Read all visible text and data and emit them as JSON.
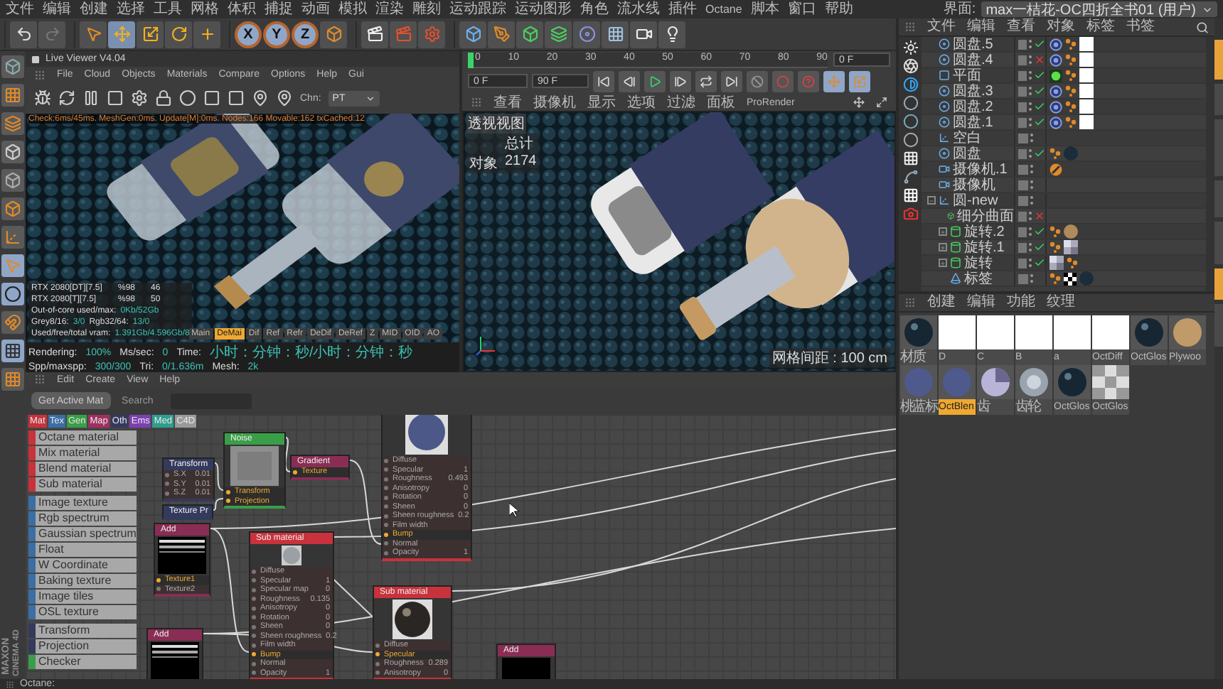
{
  "menu_bar": [
    "文件",
    "编辑",
    "创建",
    "选择",
    "工具",
    "网格",
    "体积",
    "捕捉",
    "动画",
    "模拟",
    "渲染",
    "雕刻",
    "运动跟踪",
    "运动图形",
    "角色",
    "流水线",
    "插件",
    "Octane",
    "脚本",
    "窗口",
    "帮助"
  ],
  "layout": {
    "label": "界面:",
    "value": "max一桔花-OC四折全书01 (用户)"
  },
  "toolbar": {
    "axes": [
      "X",
      "Y",
      "Z"
    ]
  },
  "live_viewer": {
    "title": "Live Viewer V4.04",
    "menu": [
      "File",
      "Cloud",
      "Objects",
      "Materials",
      "Compare",
      "Options",
      "Help",
      "Gui"
    ],
    "channel": {
      "label": "Chn:",
      "value": "PT"
    },
    "check_line": "Check:6ms/45ms. MeshGen:0ms. Update[M]:0ms. Nodes:166 Movable:162 txCached:12",
    "gpus": [
      {
        "name": "RTX 2080[DT][7.5]",
        "load": "%98",
        "temp": "46"
      },
      {
        "name": "RTX 2080[T][7.5]",
        "load": "%98",
        "temp": "50"
      }
    ],
    "memory_lines": [
      [
        {
          "label": "Out-of-core used/max:",
          "value": "0Kb/52Gb"
        }
      ],
      [
        {
          "label": "Grey8/16:",
          "value": "3/0"
        },
        {
          "label": "Rgb32/64:",
          "value": "13/0"
        }
      ],
      [
        {
          "label": "Used/free/total vram:",
          "value": "1.391Gb/4.596Gb/8"
        }
      ]
    ],
    "passes": [
      {
        "label": "Main",
        "selected": false
      },
      {
        "label": "DeMai",
        "selected": true
      },
      {
        "label": "Dif",
        "selected": false
      },
      {
        "label": "Ref",
        "selected": false
      },
      {
        "label": "Refr",
        "selected": false
      },
      {
        "label": "DeDif",
        "selected": false
      },
      {
        "label": "DeRef",
        "selected": false
      },
      {
        "label": "Z",
        "selected": false
      },
      {
        "label": "MID",
        "selected": false
      },
      {
        "label": "OID",
        "selected": false
      },
      {
        "label": "AO",
        "selected": false
      }
    ],
    "status": [
      {
        "label": "Rendering:",
        "value": "100%"
      },
      {
        "label": "Ms/sec:",
        "value": "0"
      },
      {
        "label": "Time:",
        "value": "小时：分钟：秒/小时：分钟：秒"
      },
      {
        "label": "Spp/maxspp:",
        "value": "300/300"
      },
      {
        "label": "Tri:",
        "value": "0/1.636m"
      },
      {
        "label": "Mesh:",
        "value": "2k"
      }
    ]
  },
  "timeline": {
    "ticks": [
      "0",
      "10",
      "20",
      "30",
      "40",
      "50",
      "60",
      "70",
      "80",
      "90"
    ],
    "current_field": "0 F",
    "start_field": "0 F",
    "end_field": "90 F"
  },
  "viewport": {
    "menu": [
      "查看",
      "摄像机",
      "显示",
      "选项",
      "过滤",
      "面板",
      "ProRender"
    ],
    "view_name": "透视视图",
    "stats_header": "总计",
    "stats": [
      {
        "label": "对象",
        "value": "2174"
      }
    ],
    "grid_spacing": "网格间距 : 100 cm"
  },
  "object_manager": {
    "menu": [
      "文件",
      "编辑",
      "查看",
      "对象",
      "标签",
      "书签"
    ],
    "items": [
      {
        "name": "圆盘.5",
        "kind": "disc",
        "render": true,
        "tags": [
          {
            "kind": "octane"
          },
          {
            "kind": "phong"
          },
          {
            "kind": "white"
          }
        ]
      },
      {
        "name": "圆盘.4",
        "kind": "disc",
        "render": false,
        "tags": [
          {
            "kind": "octane"
          },
          {
            "kind": "phong"
          },
          {
            "kind": "white"
          }
        ]
      },
      {
        "name": "平面",
        "kind": "plane",
        "render": true,
        "tags": [
          {
            "kind": "light"
          },
          {
            "kind": "phong"
          },
          {
            "kind": "white"
          }
        ]
      },
      {
        "name": "圆盘.3",
        "kind": "disc",
        "render": true,
        "tags": [
          {
            "kind": "octane"
          },
          {
            "kind": "phong"
          },
          {
            "kind": "white"
          }
        ]
      },
      {
        "name": "圆盘.2",
        "kind": "disc",
        "render": true,
        "tags": [
          {
            "kind": "octane"
          },
          {
            "kind": "phong"
          },
          {
            "kind": "white"
          }
        ]
      },
      {
        "name": "圆盘.1",
        "kind": "disc",
        "render": true,
        "tags": [
          {
            "kind": "octane"
          },
          {
            "kind": "phong"
          },
          {
            "kind": "white"
          }
        ]
      },
      {
        "name": "空白",
        "kind": "null"
      },
      {
        "name": "圆盘",
        "kind": "disc",
        "render": true,
        "tags": [
          {
            "kind": "phong"
          },
          {
            "kind": "dark"
          }
        ]
      },
      {
        "name": "摄像机.1",
        "kind": "camera",
        "tags": [
          {
            "kind": "target"
          }
        ]
      },
      {
        "name": "摄像机",
        "kind": "camera"
      },
      {
        "name": "圆-new",
        "kind": "null",
        "expanded": true,
        "children": [
          {
            "name": "细分曲面",
            "kind": "subdivision",
            "render": false
          },
          {
            "name": "旋转.2",
            "kind": "lathe",
            "expanded": false,
            "render": true,
            "tags": [
              {
                "kind": "phong"
              },
              {
                "kind": "sand"
              }
            ]
          },
          {
            "name": "旋转.1",
            "kind": "lathe",
            "expanded": false,
            "render": true,
            "tags": [
              {
                "kind": "phong"
              },
              {
                "kind": "pattern"
              }
            ]
          },
          {
            "name": "旋转",
            "kind": "lathe",
            "expanded": false,
            "render": true,
            "tags": [
              {
                "kind": "pattern"
              },
              {
                "kind": "phong"
              }
            ]
          },
          {
            "name": "标签",
            "kind": "label",
            "tags": [
              {
                "kind": "phong"
              },
              {
                "kind": "checker"
              },
              {
                "kind": "dark"
              }
            ]
          }
        ]
      }
    ]
  },
  "material_manager": {
    "menu": [
      "创建",
      "编辑",
      "功能",
      "纹理"
    ],
    "materials": [
      {
        "name": "材质",
        "kind": "dark",
        "selected": false
      },
      {
        "name": "D",
        "kind": "white",
        "selected": false
      },
      {
        "name": "C",
        "kind": "white",
        "selected": false
      },
      {
        "name": "B",
        "kind": "white",
        "selected": false
      },
      {
        "name": "a",
        "kind": "white",
        "selected": false
      },
      {
        "name": "OctDiff",
        "kind": "white",
        "selected": false
      },
      {
        "name": "OctGlos",
        "kind": "dark",
        "selected": false
      },
      {
        "name": "Plywoo",
        "kind": "sand",
        "selected": false
      },
      {
        "name": "桃蓝标",
        "kind": "blue",
        "selected": false
      },
      {
        "name": "OctBlen",
        "kind": "blue",
        "selected": true
      },
      {
        "name": "齿",
        "kind": "pattern",
        "selected": false
      },
      {
        "name": "齿轮",
        "kind": "glass",
        "selected": false
      },
      {
        "name": "OctGlos",
        "kind": "dark",
        "selected": false
      },
      {
        "name": "OctGlos",
        "kind": "checker",
        "selected": false
      }
    ]
  },
  "node_editor": {
    "menu": [
      "Edit",
      "Create",
      "View",
      "Help"
    ],
    "get_button": "Get Active Mat",
    "search": {
      "placeholder": "Search"
    },
    "categories": [
      {
        "label": "Mat",
        "color": "#c8323c"
      },
      {
        "label": "Tex",
        "color": "#3a6ea5"
      },
      {
        "label": "Gen",
        "color": "#3a9e48"
      },
      {
        "label": "Map",
        "color": "#a03060"
      },
      {
        "label": "Oth",
        "color": "#343a5c"
      },
      {
        "label": "Ems",
        "color": "#7e3fb0"
      },
      {
        "label": "Med",
        "color": "#2e9e8e"
      },
      {
        "label": "C4D",
        "color": "#9a9a9a"
      }
    ],
    "node_types": [
      {
        "label": "Octane material",
        "color": "#c8323c"
      },
      {
        "label": "Mix material",
        "color": "#c8323c"
      },
      {
        "label": "Blend material",
        "color": "#c8323c"
      },
      {
        "label": "Sub material",
        "color": "#c8323c"
      },
      {
        "label": "Image texture",
        "color": "#3a6ea5"
      },
      {
        "label": "Rgb spectrum",
        "color": "#3a6ea5"
      },
      {
        "label": "Gaussian spectrum",
        "color": "#3a6ea5"
      },
      {
        "label": "Float",
        "color": "#3a6ea5"
      },
      {
        "label": "W Coordinate",
        "color": "#3a6ea5"
      },
      {
        "label": "Baking texture",
        "color": "#3a6ea5"
      },
      {
        "label": "Image tiles",
        "color": "#3a6ea5"
      },
      {
        "label": "OSL texture",
        "color": "#3a6ea5"
      },
      {
        "label": "Transform",
        "color": "#343a5c"
      },
      {
        "label": "Projection",
        "color": "#343a5c"
      },
      {
        "label": "Checker",
        "color": "#3a9e48"
      }
    ],
    "nodes": [
      {
        "title": "Transform",
        "kind": "oth",
        "ports": [
          {
            "label": "S.X",
            "value": "0.01",
            "connected": false
          },
          {
            "label": "S.Y",
            "value": "0.01",
            "connected": false
          },
          {
            "label": "S.Z",
            "value": "0.01",
            "connected": false
          }
        ]
      },
      {
        "title": "Texture Pr",
        "kind": "oth"
      },
      {
        "title": "Noise",
        "kind": "gen",
        "preview": {
          "kind": "noise"
        },
        "ports": [
          {
            "label": "Transform",
            "connected": true
          },
          {
            "label": "Projection",
            "connected": true
          }
        ]
      },
      {
        "title": "Gradient",
        "kind": "map",
        "ports": [
          {
            "label": "Texture",
            "connected": true
          }
        ]
      },
      {
        "kind": "mat",
        "preview": {
          "kind": "blue"
        },
        "ports": [
          {
            "label": "Diffuse",
            "connected": false
          },
          {
            "label": "Specular",
            "value": "1",
            "connected": false
          },
          {
            "label": "Roughness",
            "value": "0.493",
            "connected": false
          },
          {
            "label": "Anisotropy",
            "value": "0",
            "connected": false
          },
          {
            "label": "Rotation",
            "value": "0",
            "connected": false
          },
          {
            "label": "Sheen",
            "value": "0",
            "connected": false
          },
          {
            "label": "Sheen roughness",
            "value": "0.2",
            "connected": false
          },
          {
            "label": "Film width",
            "connected": false
          },
          {
            "label": "Bump",
            "connected": true
          },
          {
            "label": "Normal",
            "connected": false
          },
          {
            "label": "Opacity",
            "value": "1",
            "connected": false
          }
        ]
      },
      {
        "title": "Add",
        "kind": "map",
        "preview": {
          "kind": "lines"
        },
        "ports": [
          {
            "label": "Texture1",
            "connected": true
          },
          {
            "label": "Texture2",
            "connected": false
          }
        ]
      },
      {
        "title": "Sub material",
        "kind": "mat",
        "preview": {
          "kind": "glass"
        },
        "ports": [
          {
            "label": "Diffuse",
            "connected": false
          },
          {
            "label": "Specular",
            "value": "1",
            "connected": false
          },
          {
            "label": "Specular map",
            "value": "0",
            "connected": false
          },
          {
            "label": "Roughness",
            "value": "0.135",
            "connected": false
          },
          {
            "label": "Anisotropy",
            "value": "0",
            "connected": false
          },
          {
            "label": "Rotation",
            "value": "0",
            "connected": false
          },
          {
            "label": "Sheen",
            "value": "0",
            "connected": false
          },
          {
            "label": "Sheen roughness",
            "value": "0.2",
            "connected": false
          },
          {
            "label": "Film width",
            "connected": false
          },
          {
            "label": "Bump",
            "connected": true
          },
          {
            "label": "Normal",
            "connected": false
          },
          {
            "label": "Opacity",
            "value": "1",
            "connected": false
          }
        ]
      },
      {
        "title": "Add",
        "kind": "map",
        "preview": {
          "kind": "lines"
        }
      },
      {
        "title": "Sub material",
        "kind": "mat",
        "preview": {
          "kind": "dark"
        },
        "ports": [
          {
            "label": "Diffuse",
            "connected": false
          },
          {
            "label": "Specular",
            "connected": true
          },
          {
            "label": "Roughness",
            "value": "0.289",
            "connected": false
          },
          {
            "label": "Anisotropy",
            "value": "0",
            "connected": false
          }
        ]
      },
      {
        "title": "Add",
        "kind": "map",
        "preview": {
          "kind": "black"
        }
      }
    ]
  },
  "side_tabs": [
    {
      "selected": true
    },
    {
      "selected": false
    },
    {
      "selected": false
    },
    {
      "selected": false
    },
    {
      "selected": false
    },
    {
      "selected": true
    },
    {
      "selected": false
    }
  ],
  "brand": [
    "MAXON",
    "CINEMA 4D"
  ],
  "status_bar": "Octane:"
}
